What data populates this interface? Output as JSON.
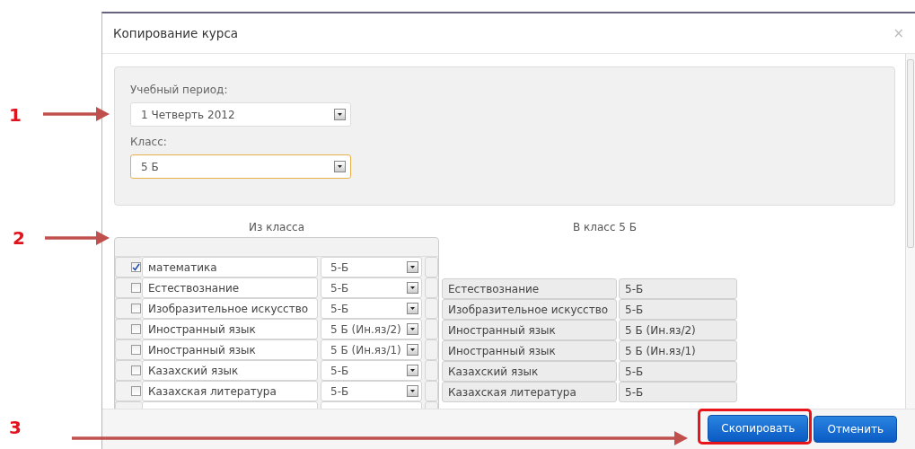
{
  "annotations": [
    {
      "label": "1"
    },
    {
      "label": "2"
    },
    {
      "label": "3"
    }
  ],
  "dialog": {
    "title": "Копирование курса",
    "close": "×",
    "fields": [
      {
        "label": "Учебный период:",
        "value": "1 Четверть 2012",
        "focused": false
      },
      {
        "label": "Класс:",
        "value": "5 Б",
        "focused": true
      }
    ],
    "source": {
      "heading": "Из класса",
      "rows": [
        {
          "checked": true,
          "subject": "математика",
          "class": "5-Б"
        },
        {
          "checked": false,
          "subject": "Естествознание",
          "class": "5-Б"
        },
        {
          "checked": false,
          "subject": "Изобразительное искусство",
          "class": "5-Б"
        },
        {
          "checked": false,
          "subject": "Иностранный язык",
          "class": "5 Б (Ин.яз/2)"
        },
        {
          "checked": false,
          "subject": "Иностранный язык",
          "class": "5 Б (Ин.яз/1)"
        },
        {
          "checked": false,
          "subject": "Казахский язык",
          "class": "5-Б"
        },
        {
          "checked": false,
          "subject": "Казахская литература",
          "class": "5-Б"
        }
      ]
    },
    "target": {
      "heading": "В класс 5 Б",
      "rows": [
        {
          "subject": "Естествознание",
          "class": "5-Б"
        },
        {
          "subject": "Изобразительное искусство",
          "class": "5-Б"
        },
        {
          "subject": "Иностранный язык",
          "class": "5 Б (Ин.яз/2)"
        },
        {
          "subject": "Иностранный язык",
          "class": "5 Б (Ин.яз/1)"
        },
        {
          "subject": "Казахский язык",
          "class": "5-Б"
        },
        {
          "subject": "Казахская литература",
          "class": "5-Б"
        }
      ]
    },
    "buttons": [
      {
        "label": "Скопировать",
        "highlighted": true
      },
      {
        "label": "Отменить",
        "highlighted": false
      }
    ]
  }
}
